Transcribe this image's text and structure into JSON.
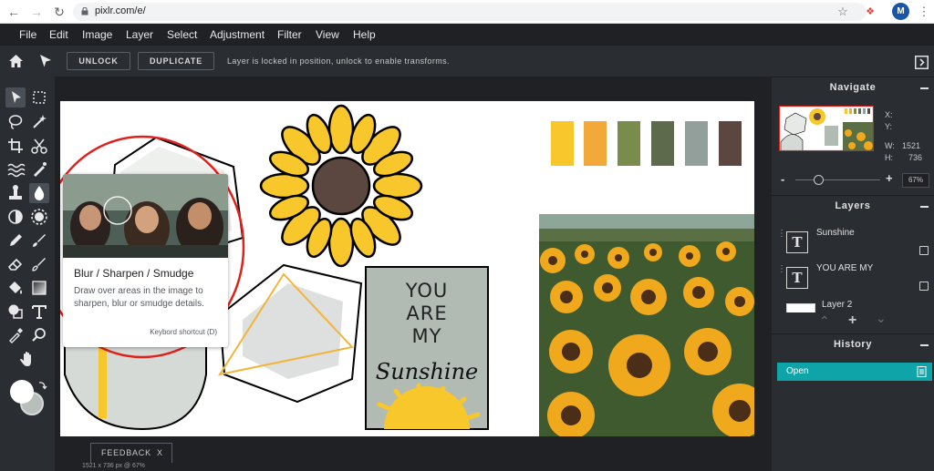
{
  "browser": {
    "url": "pixlr.com/e/",
    "avatar_letter": "M"
  },
  "menu": [
    "File",
    "Edit",
    "Image",
    "Layer",
    "Select",
    "Adjustment",
    "Filter",
    "View",
    "Help"
  ],
  "toolbar": {
    "unlock_label": "UNLOCK",
    "duplicate_label": "DUPLICATE",
    "message": "Layer is locked in position, unlock to enable transforms."
  },
  "tooltip": {
    "title": "Blur / Sharpen / Smudge",
    "description": "Draw over areas in the image to sharpen, blur or smudge details.",
    "shortcut": "Keybord shortcut (D)"
  },
  "canvas": {
    "poster_line1": "YOU",
    "poster_line2": "ARE",
    "poster_line3": "MY",
    "poster_script": "Sunshine",
    "swatches": [
      "#f7c72b",
      "#f3a83a",
      "#7a8c4b",
      "#5d6b4c",
      "#939f9a",
      "#5c4740"
    ]
  },
  "navigate": {
    "title": "Navigate",
    "x_label": "X:",
    "y_label": "Y:",
    "w_label": "W:",
    "w_value": "1521",
    "h_label": "H:",
    "h_value": "736",
    "zoom": "67%",
    "zoom_minus": "-",
    "zoom_plus": "+"
  },
  "layers": {
    "title": "Layers",
    "items": [
      {
        "name": "Sunshine",
        "thumb": "T"
      },
      {
        "name": "YOU ARE MY",
        "thumb": "T"
      },
      {
        "name": "Layer 2",
        "thumb": ""
      }
    ]
  },
  "history": {
    "title": "History",
    "items": [
      "Open"
    ]
  },
  "footer": {
    "feedback_label": "FEEDBACK",
    "feedback_close": "X",
    "status": "1521 x 736 px @ 67%"
  },
  "colors": {
    "accent": "#0fa4a8",
    "annotation_red": "#e0201b",
    "foreground": "#ffffff",
    "background": "#b7bfbb"
  }
}
